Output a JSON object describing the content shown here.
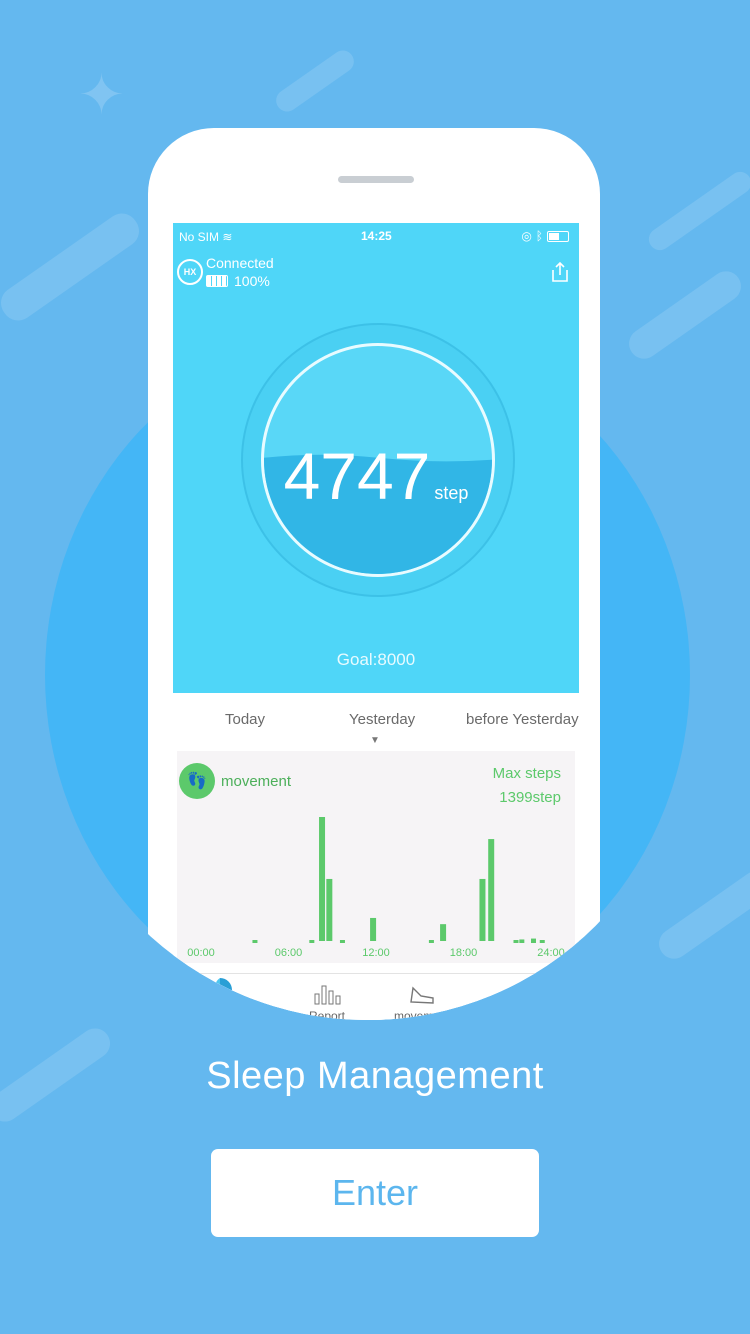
{
  "status_bar": {
    "carrier": "No SIM",
    "time": "14:25"
  },
  "device": {
    "logo": "HX",
    "status": "Connected",
    "battery": "100%",
    "battery_level": 1.0
  },
  "steps": {
    "value": "4747",
    "unit": "step",
    "goal_label": "Goal:8000",
    "progress": 0.593
  },
  "tabs": [
    {
      "label": "Today"
    },
    {
      "label": "Yesterday",
      "selected": true
    },
    {
      "label": "before Yesterday"
    }
  ],
  "movement": {
    "label": "movement",
    "max_steps_label": "Max steps",
    "max_steps_value": "1399step"
  },
  "chart_data": {
    "type": "bar",
    "x_ticks": [
      "00:00",
      "06:00",
      "12:00",
      "18:00",
      "24:00"
    ],
    "x_unit": "hour",
    "xlim": [
      0,
      24
    ],
    "ylim": [
      0,
      1399
    ],
    "color": "#5cc96b",
    "bars": [
      {
        "x": 8.3,
        "y": 1399
      },
      {
        "x": 8.8,
        "y": 700
      },
      {
        "x": 11.8,
        "y": 260
      },
      {
        "x": 16.6,
        "y": 190
      },
      {
        "x": 19.3,
        "y": 700
      },
      {
        "x": 19.9,
        "y": 1150
      }
    ],
    "small_points": [
      {
        "x": 3.7,
        "y": 10
      },
      {
        "x": 7.6,
        "y": 20
      },
      {
        "x": 9.7,
        "y": 10
      },
      {
        "x": 15.8,
        "y": 10
      },
      {
        "x": 21.6,
        "y": 25
      },
      {
        "x": 22.0,
        "y": 40
      },
      {
        "x": 22.8,
        "y": 50
      },
      {
        "x": 23.4,
        "y": 30
      }
    ]
  },
  "bottom_nav": [
    {
      "label": "Report"
    },
    {
      "label": "movement"
    }
  ],
  "slide_title": "Sleep Management",
  "enter_label": "Enter",
  "colors": {
    "background": "#64b8ef",
    "circle": "#44b6f6",
    "screen_top": "#4fd6f8",
    "accent_green": "#5cc96b",
    "enter_text": "#5cb6ee"
  }
}
